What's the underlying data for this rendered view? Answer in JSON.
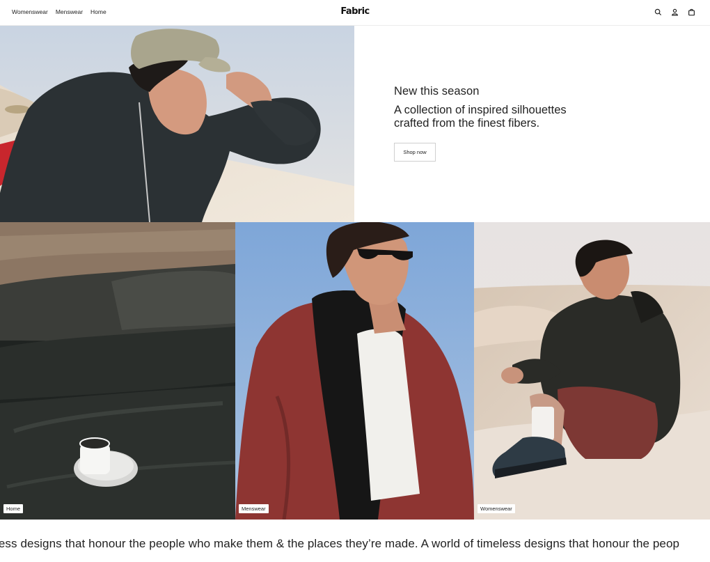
{
  "header": {
    "nav": [
      "Womenswear",
      "Menswear",
      "Home"
    ],
    "logo": "Fabric",
    "icons": [
      "search-icon",
      "user-icon",
      "bag-icon"
    ]
  },
  "hero": {
    "eyebrow": "New this season",
    "title": "A collection of inspired silhouettes crafted from the finest fibers.",
    "cta": "Shop now"
  },
  "tiles": [
    {
      "label": "Home"
    },
    {
      "label": "Menswear"
    },
    {
      "label": "Womenswear"
    }
  ],
  "marquee": {
    "text": "less designs that honour the people who make them & the places they’re made.  A world of timeless designs that honour the peop"
  }
}
